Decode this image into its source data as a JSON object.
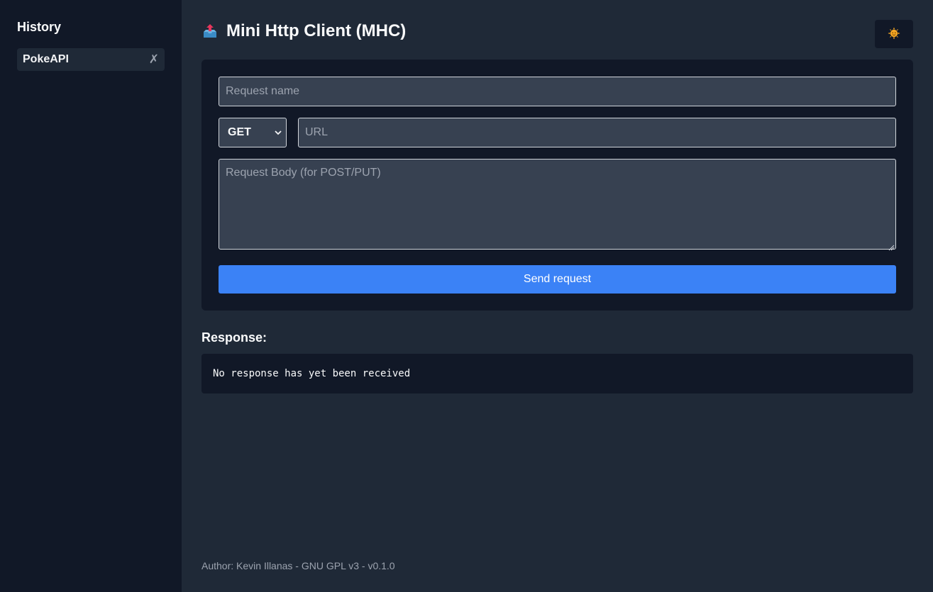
{
  "sidebar": {
    "title": "History",
    "items": [
      {
        "label": "PokeAPI",
        "delete_glyph": "✗"
      }
    ]
  },
  "header": {
    "title": "Mini Http Client (MHC)",
    "title_icon": "outbox-tray-icon",
    "theme_toggle_icon": "sun-face-icon"
  },
  "form": {
    "name_placeholder": "Request name",
    "method": {
      "selected": "GET",
      "options": [
        "GET"
      ]
    },
    "url_placeholder": "URL",
    "body_placeholder": "Request Body (for POST/PUT)",
    "send_label": "Send request"
  },
  "response": {
    "title": "Response:",
    "text": "No response has yet been received"
  },
  "footer": {
    "text": "Author: Kevin Illanas - GNU GPL v3 - v0.1.0"
  },
  "colors": {
    "sidebar_bg": "#111827",
    "main_bg": "#1f2937",
    "accent": "#3b82f6",
    "input_bg": "#374151"
  }
}
